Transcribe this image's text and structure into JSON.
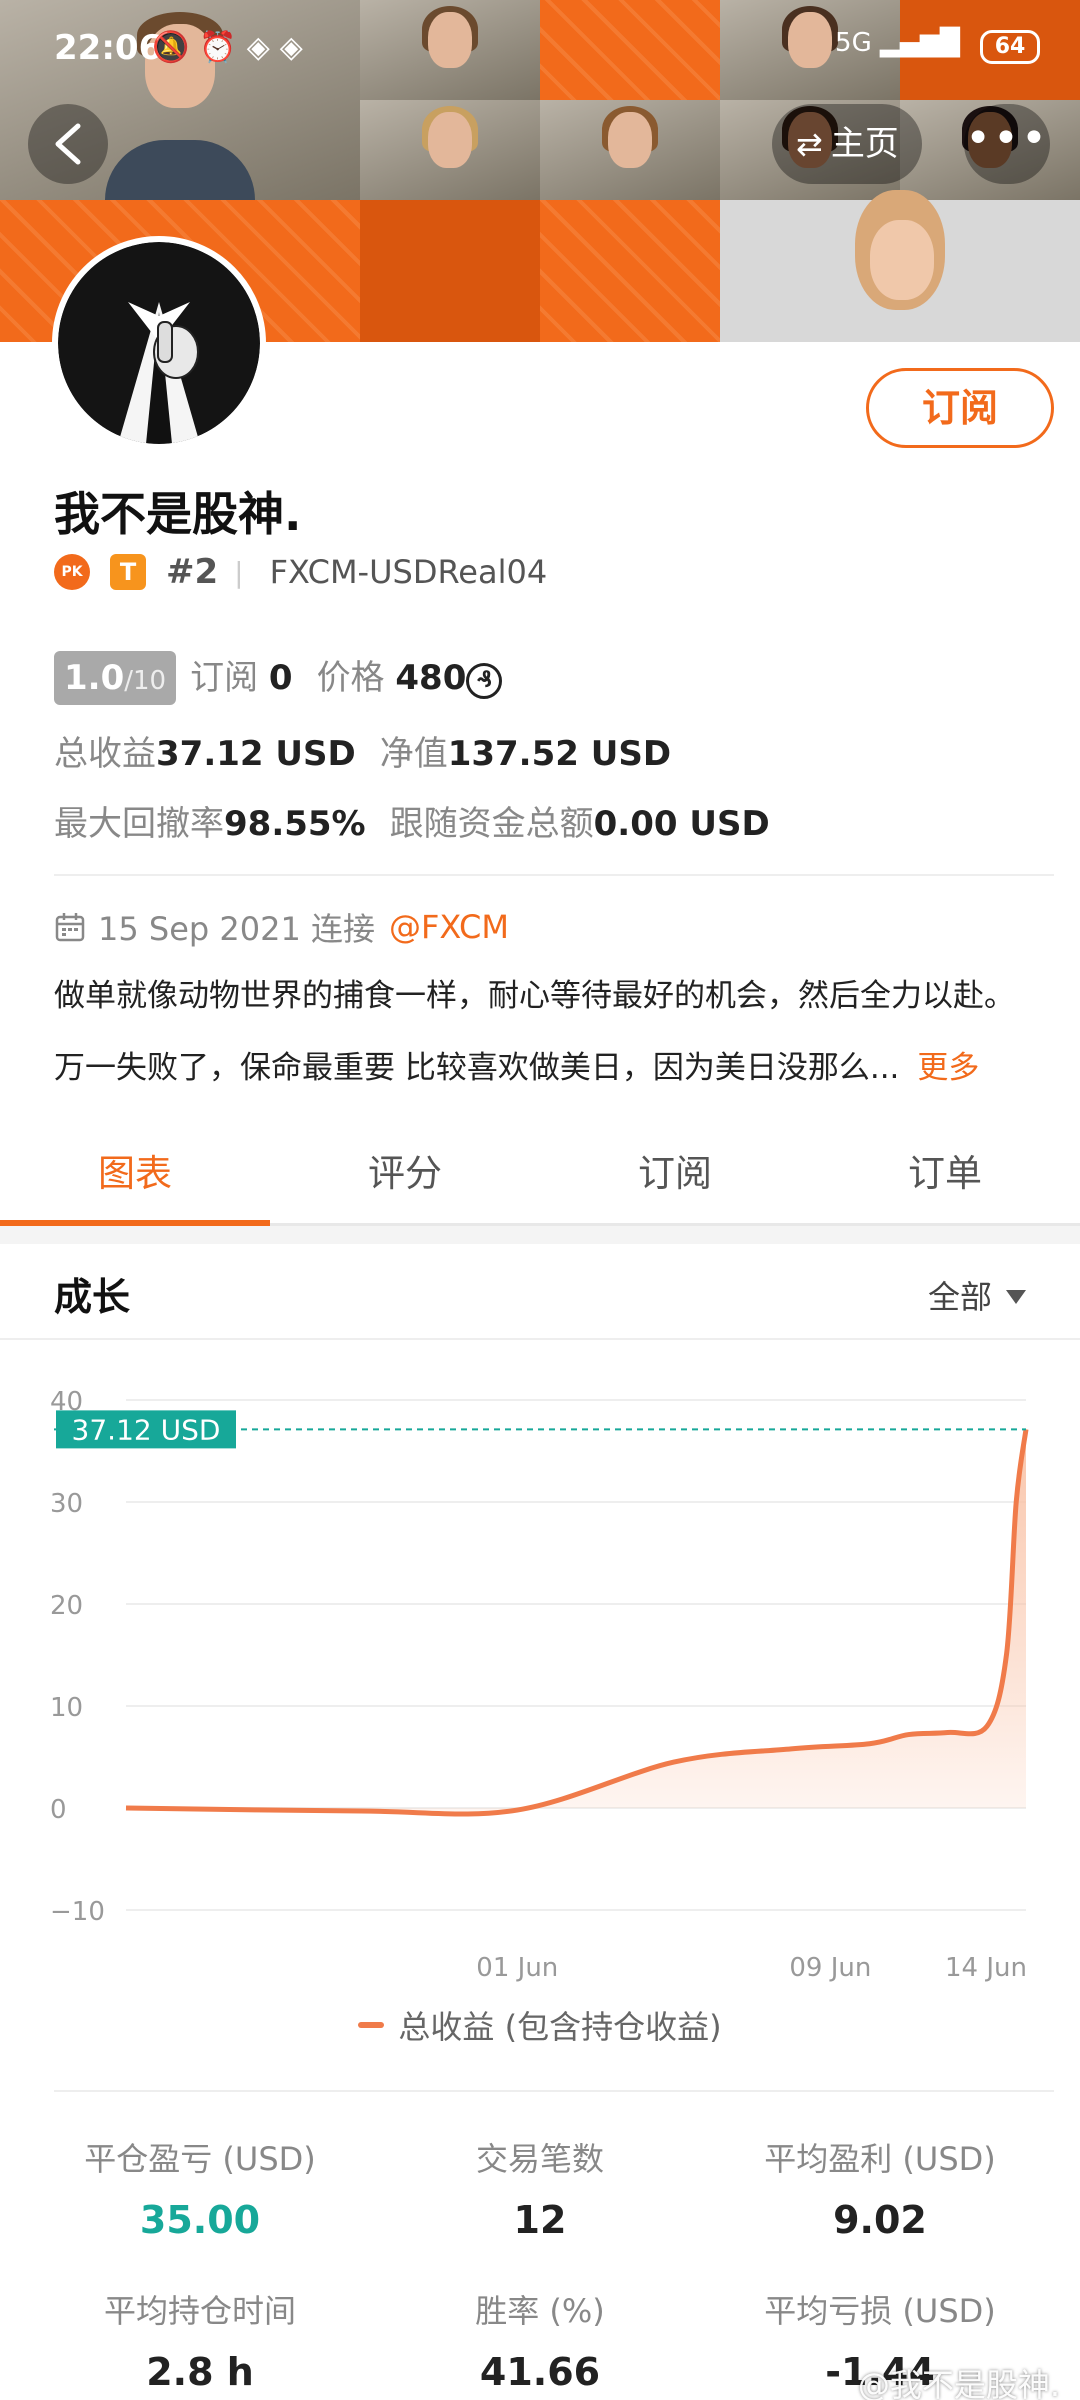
{
  "status_bar": {
    "time": "22:06",
    "signal": "5G",
    "battery": "64"
  },
  "header": {
    "home_label": "主页",
    "more_label": "•••"
  },
  "profile": {
    "name": "我不是股神.",
    "pk_badge": "PK",
    "t_badge": "T",
    "rank": "#2",
    "account": "FXCM-USDReal04",
    "subscribe_label": "订阅"
  },
  "stats": {
    "score": "1.0",
    "score_max": "/10",
    "subscribe_label": "订阅",
    "subscribe_count": "0",
    "price_label": "价格",
    "price_value": "480",
    "coin_symbol": "₰",
    "total_profit_label": "总收益",
    "total_profit_value": "37.12 USD",
    "net_value_label": "净值",
    "net_value_value": "137.52 USD",
    "drawdown_label": "最大回撤率",
    "drawdown_value": "98.55%",
    "follow_label": "跟随资金总额",
    "follow_value": "0.00 USD"
  },
  "connection": {
    "date": "15 Sep 2021 连接",
    "broker": "@FXCM"
  },
  "bio": {
    "line1": "做单就像动物世界的捕食一样，耐心等待最好的机会，然后全力以赴。",
    "line2": "万一失败了，保命最重要 比较喜欢做美日，因为美日没那么...",
    "more": "更多"
  },
  "tabs": [
    "图表",
    "评分",
    "订阅",
    "订单"
  ],
  "growth": {
    "title": "成长",
    "range": "全部"
  },
  "chart_data": {
    "type": "area",
    "series": [
      {
        "name": "总收益 (包含持仓收益)",
        "points": [
          {
            "x": "2021-05-22",
            "y": 0.0
          },
          {
            "x": "2021-05-28",
            "y": -0.3
          },
          {
            "x": "2021-06-01",
            "y": -0.2
          },
          {
            "x": "2021-06-05",
            "y": 4.5
          },
          {
            "x": "2021-06-08",
            "y": 5.8
          },
          {
            "x": "2021-06-10",
            "y": 6.3
          },
          {
            "x": "2021-06-11",
            "y": 7.2
          },
          {
            "x": "2021-06-12",
            "y": 7.4
          },
          {
            "x": "2021-06-13",
            "y": 8.0
          },
          {
            "x": "2021-06-13T12",
            "y": 15
          },
          {
            "x": "2021-06-13T18",
            "y": 30
          },
          {
            "x": "2021-06-14",
            "y": 37.12
          }
        ]
      }
    ],
    "ylim": [
      -10,
      40
    ],
    "yticks": [
      "40",
      "30",
      "20",
      "10",
      "0",
      "−10"
    ],
    "xticks": [
      "01 Jun",
      "09 Jun",
      "14 Jun"
    ],
    "current_label": "37.12 USD",
    "grid": true,
    "legend": "bottom",
    "colors": {
      "line": "#f07b4a",
      "fill": "#f9c2a6",
      "marker": "#17a899"
    }
  },
  "metrics_row1": [
    {
      "label": "平仓盈亏 (USD)",
      "value": "35.00"
    },
    {
      "label": "交易笔数",
      "value": "12"
    },
    {
      "label": "平均盈利 (USD)",
      "value": "9.02"
    }
  ],
  "metrics_row2": [
    {
      "label": "平均持仓时间",
      "value": "2.8 h"
    },
    {
      "label": "胜率 (%)",
      "value": "41.66"
    },
    {
      "label": "平均亏损 (USD)",
      "value": "-1.44"
    }
  ],
  "watermark": "@我不是股神."
}
